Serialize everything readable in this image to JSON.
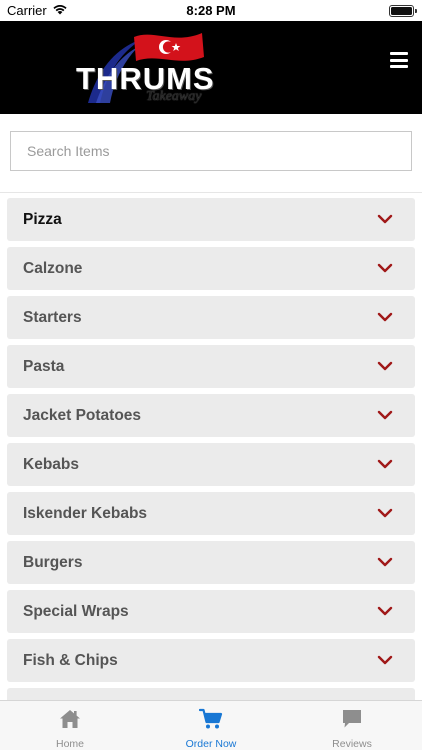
{
  "status_bar": {
    "carrier": "Carrier",
    "time": "8:28 PM"
  },
  "header": {
    "logo_text": "THRUMS",
    "logo_subtext": "Takeaway"
  },
  "search": {
    "placeholder": "Search Items",
    "value": ""
  },
  "categories": [
    {
      "label": "Pizza"
    },
    {
      "label": "Calzone"
    },
    {
      "label": "Starters"
    },
    {
      "label": "Pasta"
    },
    {
      "label": "Jacket Potatoes"
    },
    {
      "label": "Kebabs"
    },
    {
      "label": "Iskender Kebabs"
    },
    {
      "label": "Burgers"
    },
    {
      "label": "Special Wraps"
    },
    {
      "label": "Fish & Chips"
    },
    {
      "label": ""
    }
  ],
  "tab_bar": {
    "tabs": [
      {
        "label": "Home",
        "icon": "home-icon"
      },
      {
        "label": "Order Now",
        "icon": "cart-icon"
      },
      {
        "label": "Reviews",
        "icon": "chat-bubble-icon"
      }
    ],
    "active_index": 1
  },
  "colors": {
    "header_bg": "#000000",
    "chevron": "#a01818",
    "active_tab": "#1877d4",
    "inactive_tab": "#8e8e8e",
    "category_bg": "#ebebeb"
  }
}
